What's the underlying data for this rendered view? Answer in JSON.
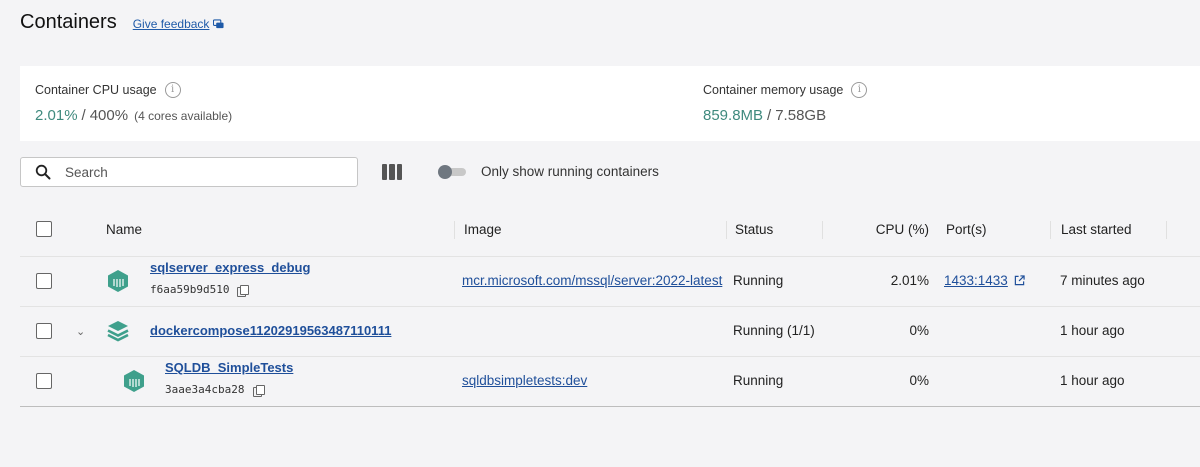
{
  "header": {
    "title": "Containers",
    "feedback_label": "Give feedback"
  },
  "stats": {
    "cpu": {
      "label": "Container CPU usage",
      "value": "2.01%",
      "separator": "/",
      "total": "400%",
      "note": "(4 cores available)"
    },
    "memory": {
      "label": "Container memory usage",
      "value": "859.8MB",
      "separator": "/",
      "total": "7.58GB"
    }
  },
  "toolbar": {
    "search_placeholder": "Search",
    "toggle_label": "Only show running containers"
  },
  "table": {
    "columns": {
      "name": "Name",
      "image": "Image",
      "status": "Status",
      "cpu": "CPU (%)",
      "ports": "Port(s)",
      "last_started": "Last started"
    },
    "rows": [
      {
        "name": "sqlserver_express_debug",
        "id": "f6aa59b9d510",
        "image": "mcr.microsoft.com/mssql/server:2022-latest",
        "status": "Running",
        "cpu": "2.01%",
        "port": "1433:1433",
        "last_started": "7 minutes ago"
      },
      {
        "name": "dockercompose11202919563487110111",
        "status": "Running (1/1)",
        "cpu": "0%",
        "last_started": "1 hour ago"
      },
      {
        "name": "SQLDB_SimpleTests",
        "id": "3aae3a4cba28",
        "image": "sqldbsimpletests:dev",
        "status": "Running",
        "cpu": "0%",
        "last_started": "1 hour ago"
      }
    ]
  },
  "colors": {
    "accent_green": "#3f8a7e",
    "link_blue": "#1f4f9a",
    "container_icon": "#3fa08c"
  },
  "icons": {
    "container": "container-icon",
    "compose": "stack-icon",
    "search": "search-icon",
    "info": "info-icon",
    "copy": "copy-icon",
    "external": "external-link-icon"
  }
}
